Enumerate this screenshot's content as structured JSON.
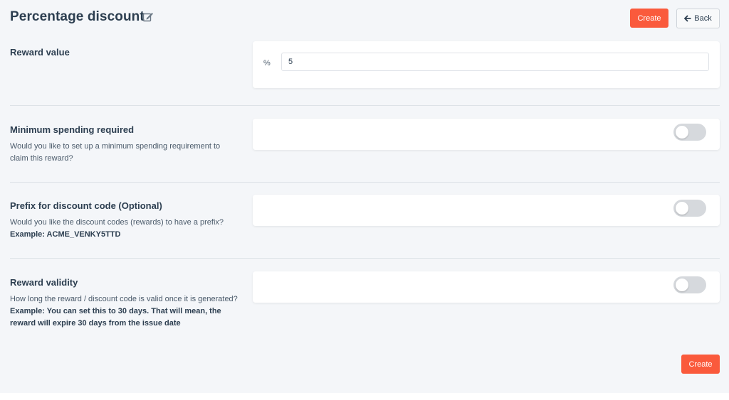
{
  "header": {
    "title": "Percentage discount",
    "create_label": "Create",
    "back_label": "Back"
  },
  "reward_value": {
    "label": "Reward value",
    "unit": "%",
    "value": "5"
  },
  "minimum_spending": {
    "label": "Minimum spending required",
    "description": "Would you like to set up a minimum spending requirement to claim this reward?",
    "enabled": false
  },
  "prefix": {
    "label": "Prefix for discount code (Optional)",
    "description": "Would you like the discount codes (rewards) to have a prefix?",
    "example": "Example: ACME_VENKY5TTD",
    "enabled": false
  },
  "validity": {
    "label": "Reward validity",
    "description": "How long the reward / discount code is valid once it is generated?",
    "example": "Example: You can set this to 30 days. That will mean, the reward will expire 30 days from the issue date",
    "enabled": false
  },
  "footer": {
    "create_label": "Create"
  },
  "colors": {
    "accent": "#fa5a3c",
    "background": "#f4f6f9",
    "toggle_off": "#d6d9dd"
  }
}
